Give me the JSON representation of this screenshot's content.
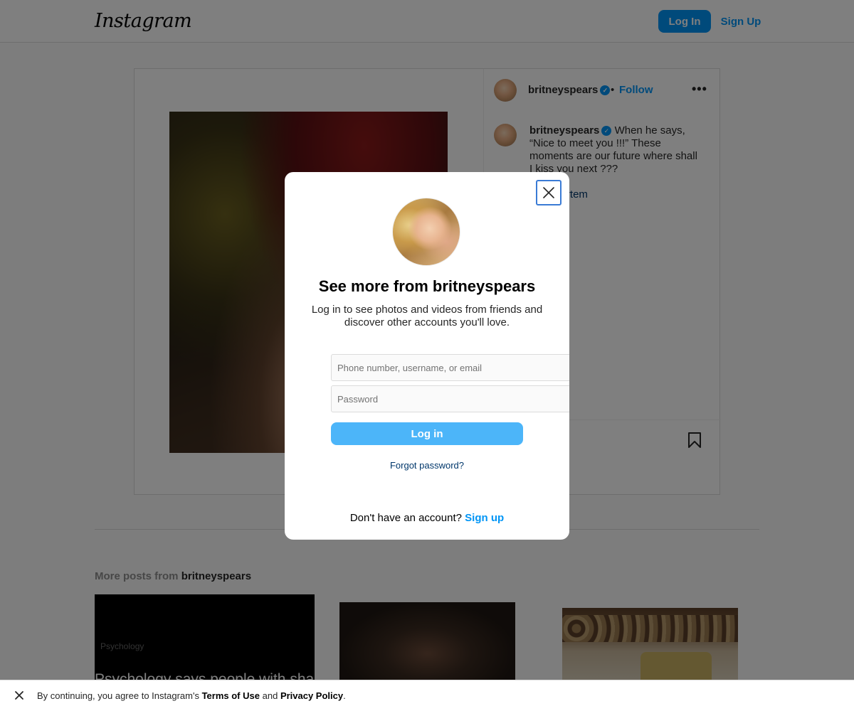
{
  "header": {
    "logo": "Instagram",
    "login_label": "Log In",
    "signup_label": "Sign Up"
  },
  "post": {
    "username": "britneyspears",
    "follow_separator": "•",
    "follow_label": "Follow",
    "more_icon": "more-horizontal-icon",
    "caption_username": "britneyspears",
    "caption_text": "When he says, “Nice to meet you !!!” These moments are our future where shall I kiss you next ???",
    "tag": "@nadiartem"
  },
  "more_posts": {
    "prefix": "More posts from",
    "username": "britneyspears",
    "thumb1_text": "Psychology says people with sha",
    "thumb1_small": "Psychology"
  },
  "modal": {
    "title": "See more from britneyspears",
    "subtitle": "Log in to see photos and videos from friends and discover other accounts you'll love.",
    "username_placeholder": "Phone number, username, or email",
    "password_placeholder": "Password",
    "login_label": "Log in",
    "forgot_label": "Forgot password?",
    "no_account_text": "Don't have an account?",
    "signup_label": "Sign up"
  },
  "consent": {
    "text_prefix": "By continuing, you agree to Instagram's",
    "terms": "Terms of Use",
    "and": "and",
    "privacy": "Privacy Policy",
    "suffix": "."
  },
  "colors": {
    "primary_blue": "#0095f6",
    "login_button_light": "#4cb5f9",
    "link_dark": "#00376b",
    "overlay": "rgba(0,0,0,0.5)"
  }
}
